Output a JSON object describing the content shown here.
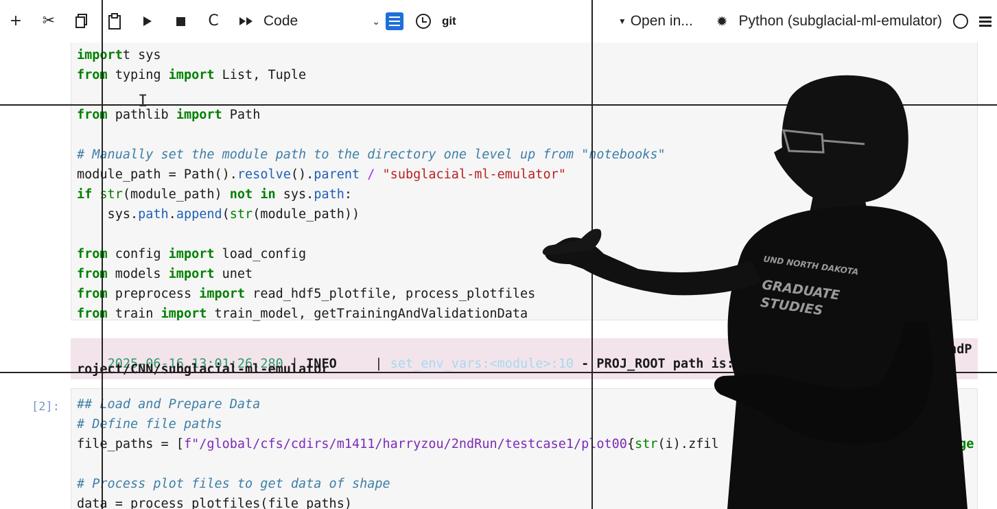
{
  "toolbar": {
    "add": "+",
    "cut": "✂",
    "copy": "⧉",
    "paste": "📋",
    "run": "▶",
    "stop": "■",
    "restart": "C",
    "run_all": "▸▸",
    "cell_type": "Code",
    "git_label": "git",
    "open_in": "Open in...",
    "kernel_name": "Python (subglacial-ml-emulator)"
  },
  "cell1": {
    "lines": [
      {
        "parts": [
          [
            "kw",
            "import"
          ],
          [
            "",
            "t sys"
          ]
        ]
      },
      {
        "parts": [
          [
            "kw",
            "from"
          ],
          [
            "",
            " typing "
          ],
          [
            "kw",
            "import"
          ],
          [
            "",
            " List, Tuple"
          ]
        ]
      },
      {
        "parts": [
          [
            "kw",
            "from"
          ],
          [
            "",
            " pathlib "
          ],
          [
            "kw",
            "import"
          ],
          [
            "",
            " Path"
          ]
        ]
      },
      {
        "parts": [
          [
            "cm",
            "# Manually set the module path to the directory one level up from \"notebooks\""
          ]
        ]
      },
      {
        "parts": [
          [
            "",
            "module_path = Path()."
          ],
          [
            "at",
            "resolve"
          ],
          [
            "",
            "()."
          ],
          [
            "at",
            "parent"
          ],
          [
            "",
            " "
          ],
          [
            "op",
            "/"
          ],
          [
            "",
            " "
          ],
          [
            "st",
            "\"subglacial-ml-emulator\""
          ]
        ]
      },
      {
        "parts": [
          [
            "kw",
            "if"
          ],
          [
            "",
            " "
          ],
          [
            "bi",
            "str"
          ],
          [
            "",
            "(module_path) "
          ],
          [
            "kw",
            "not in"
          ],
          [
            "",
            " sys."
          ],
          [
            "at",
            "path"
          ],
          [
            ":"
          ]
        ]
      },
      {
        "parts": [
          [
            "",
            "    sys."
          ],
          [
            "at",
            "path"
          ],
          [
            "",
            "."
          ],
          [
            "at",
            "append"
          ],
          [
            "",
            "("
          ],
          [
            "bi",
            "str"
          ],
          [
            "",
            "(module_path))"
          ]
        ]
      },
      {
        "parts": [
          [
            "kw",
            "from"
          ],
          [
            "",
            " config "
          ],
          [
            "kw",
            "import"
          ],
          [
            "",
            " load_config"
          ]
        ]
      },
      {
        "parts": [
          [
            "kw",
            "from"
          ],
          [
            "",
            " models "
          ],
          [
            "kw",
            "import"
          ],
          [
            "",
            " unet"
          ]
        ]
      },
      {
        "parts": [
          [
            "kw",
            "from"
          ],
          [
            "",
            " preprocess "
          ],
          [
            "kw",
            "import"
          ],
          [
            "",
            " read_hdf5_plotfile, process_plotfiles"
          ]
        ]
      },
      {
        "parts": [
          [
            "kw",
            "from"
          ],
          [
            "",
            " train "
          ],
          [
            "kw",
            "import"
          ],
          [
            "",
            " train_model, getTrainingAndValidationData"
          ]
        ]
      }
    ]
  },
  "output": {
    "timestamp": "2025-06-16 13:01:26.280",
    "sep": " | ",
    "level": "INFO",
    "sep2": "     | ",
    "module": "set_env_vars:<module>:10",
    "message": " - PROJ_ROOT path is: /g",
    "tail": "andP",
    "line2": "roject/CNN/subglacial-ml-emulator"
  },
  "cell2": {
    "prompt": "[2]:",
    "lines": [
      {
        "parts": [
          [
            "cm",
            "## Load and Prepare Data"
          ]
        ]
      },
      {
        "parts": [
          [
            "cm",
            "# Define file paths"
          ]
        ]
      },
      {
        "parts": [
          [
            "",
            "file_paths = ["
          ],
          [
            "pu",
            "f\"/global/cfs/cdirs/m1411/harryzou/2ndRun/testcase1/plot00"
          ],
          [
            "",
            "{"
          ],
          [
            "bi",
            "str"
          ],
          [
            "",
            "(i).zfil"
          ]
        ]
      },
      {
        "parts": [
          [
            "cm",
            "# Process plot files to get data of shape"
          ]
        ]
      },
      {
        "parts": [
          [
            "",
            "data = process plotfiles(file paths)"
          ]
        ]
      }
    ],
    "right_tail": "i in range"
  },
  "shirt": {
    "line1": "UND NORTH DAKOTA",
    "line2": "GRADUATE",
    "line3": "STUDIES"
  }
}
